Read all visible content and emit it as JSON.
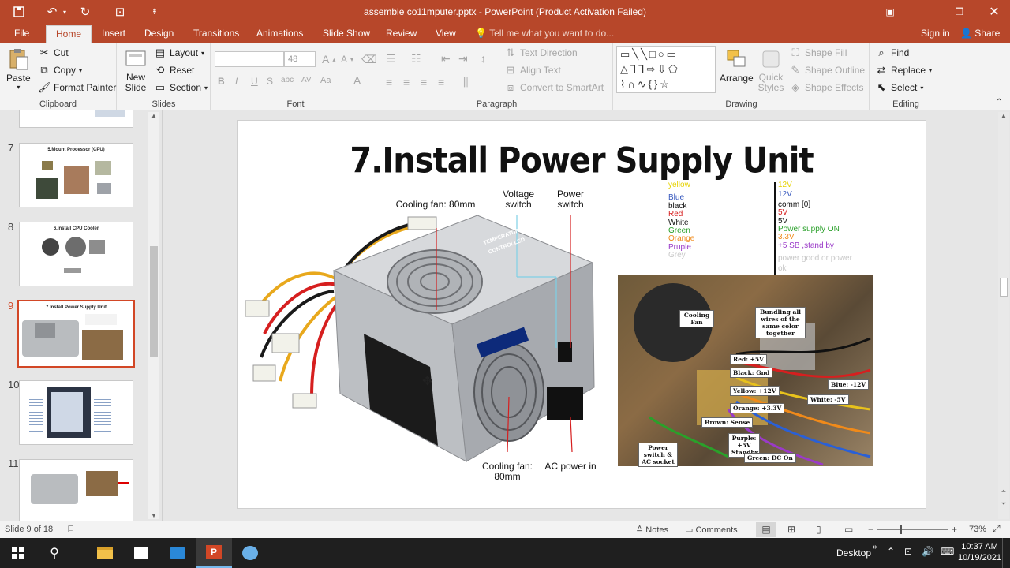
{
  "window": {
    "title": "assemble co11mputer.pptx - PowerPoint (Product Activation Failed)",
    "signin": "Sign in",
    "share": "Share"
  },
  "tabs": [
    "File",
    "Home",
    "Insert",
    "Design",
    "Transitions",
    "Animations",
    "Slide Show",
    "Review",
    "View"
  ],
  "tellme": "Tell me what you want to do...",
  "ribbon": {
    "clipboard": {
      "label": "Clipboard",
      "paste": "Paste",
      "cut": "Cut",
      "copy": "Copy",
      "format_painter": "Format Painter"
    },
    "slides": {
      "label": "Slides",
      "new_slide": "New Slide",
      "layout": "Layout",
      "reset": "Reset",
      "section": "Section"
    },
    "font": {
      "label": "Font",
      "size": "48"
    },
    "paragraph": {
      "label": "Paragraph",
      "text_direction": "Text Direction",
      "align_text": "Align Text",
      "convert_smartart": "Convert to SmartArt"
    },
    "drawing": {
      "label": "Drawing",
      "arrange": "Arrange",
      "quick_styles": "Quick Styles",
      "shape_fill": "Shape Fill",
      "shape_outline": "Shape Outline",
      "shape_effects": "Shape Effects"
    },
    "editing": {
      "label": "Editing",
      "find": "Find",
      "replace": "Replace",
      "select": "Select"
    }
  },
  "thumbnails": [
    {
      "num": "7",
      "title": "5.Mount Processor (CPU)"
    },
    {
      "num": "8",
      "title": "6.Install CPU Cooler"
    },
    {
      "num": "9",
      "title": "7.Install Power Supply Unit"
    },
    {
      "num": "10",
      "title": ""
    },
    {
      "num": "11",
      "title": ""
    }
  ],
  "slide": {
    "title": "7.Install Power Supply Unit",
    "labels": {
      "fan_top": "Cooling fan: 80mm",
      "voltage": "Voltage switch",
      "power": "Power switch",
      "fan_bottom": "Cooling fan: 80mm",
      "ac": "AC power in",
      "temp": "TEMPERATURE CONTROLLED"
    },
    "wire_colors": [
      "yellow",
      "Blue",
      "black",
      "Red",
      "White",
      "Green",
      "Orange",
      "Pruple",
      "Grey"
    ],
    "wire_voltages": [
      "12V",
      "12V",
      "comm [0]",
      "5V",
      "5V",
      "Power supply ON",
      "3.3V",
      "+5 SB ,stand by",
      "power good or power ok"
    ],
    "photo_tags": {
      "cooling_fan": "Cooling Fan",
      "bundling": "Bundling all wires of the same color together",
      "red": "Red: +5V",
      "black": "Black: Gnd",
      "yellow": "Yellow: +12V",
      "blue": "Blue: -12V",
      "white": "White: -5V",
      "orange": "Orange: +3.3V",
      "brown": "Brown: Sense",
      "purple": "Purple: +5V Standby",
      "power_switch": "Power switch & AC socket",
      "green": "Green: DC On"
    }
  },
  "status": {
    "slide_info": "Slide 9 of 18",
    "notes": "Notes",
    "comments": "Comments",
    "zoom": "73%"
  },
  "taskbar": {
    "desktop": "Desktop",
    "time": "10:37 AM",
    "date": "10/19/2021"
  },
  "colors": {
    "accent": "#b7472a",
    "ribbon_bg": "#f3f3f3",
    "selected_thumb": "#d24726"
  }
}
